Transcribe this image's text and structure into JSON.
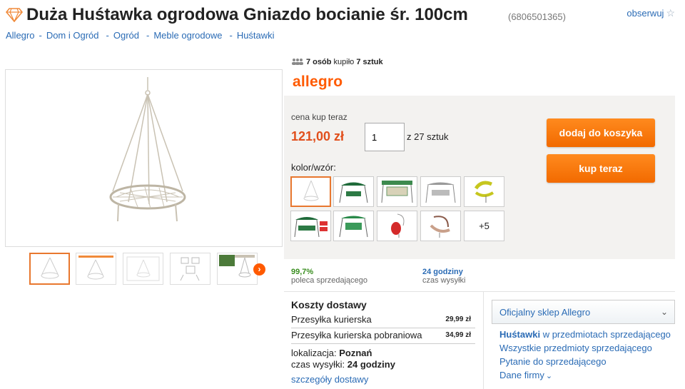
{
  "header": {
    "title": "Duża Huśtawka ogrodowa Gniazdo bocianie śr. 100cm",
    "offer_id": "(6806501365)",
    "follow_label": "obserwuj",
    "star_glyph": "☆"
  },
  "breadcrumb": {
    "items": [
      "Allegro",
      "Dom i Ogród",
      "Ogród",
      "Meble ogrodowe",
      "Huśtawki"
    ],
    "separator": "-"
  },
  "buyers": {
    "count": "7 osób",
    "verb": "kupiło",
    "pieces": "7 sztuk"
  },
  "brand": {
    "logo_text": "allegro",
    "accent_color": "#ff5a00"
  },
  "purchase": {
    "price_label": "cena kup teraz",
    "price": "121,00 zł",
    "quantity_value": "1",
    "quantity_of": "z 27 sztuk",
    "add_to_cart_label": "dodaj do koszyka",
    "buy_now_label": "kup teraz",
    "variant_label": "kolor/wzór:",
    "more_variants": "+5"
  },
  "gallery": {
    "next_glyph": "›"
  },
  "stats": {
    "recommend_value": "99,7%",
    "recommend_label": "poleca sprzedającego",
    "shipping_time_value": "24 godziny",
    "shipping_time_label": "czas wysyłki"
  },
  "shipping": {
    "title": "Koszty dostawy",
    "rows": [
      {
        "name": "Przesyłka kurierska",
        "cost": "29,99 zł"
      },
      {
        "name": "Przesyłka kurierska pobraniowa",
        "cost": "34,99 zł"
      }
    ],
    "location_label": "lokalizacja:",
    "location_value": "Poznań",
    "dispatch_label": "czas wysyłki:",
    "dispatch_value": "24 godziny",
    "details_link": "szczegóły dostawy"
  },
  "seller": {
    "official_shop": "Oficjalny sklep Allegro",
    "chevron_glyph": "⌄",
    "category_link_bold": "Huśtawki",
    "category_link_rest": "w przedmiotach sprzedającego",
    "all_items": "Wszystkie przedmioty sprzedającego",
    "ask_seller": "Pytanie do sprzedającego",
    "company_data": "Dane firmy",
    "company_chevron": "⌄"
  }
}
